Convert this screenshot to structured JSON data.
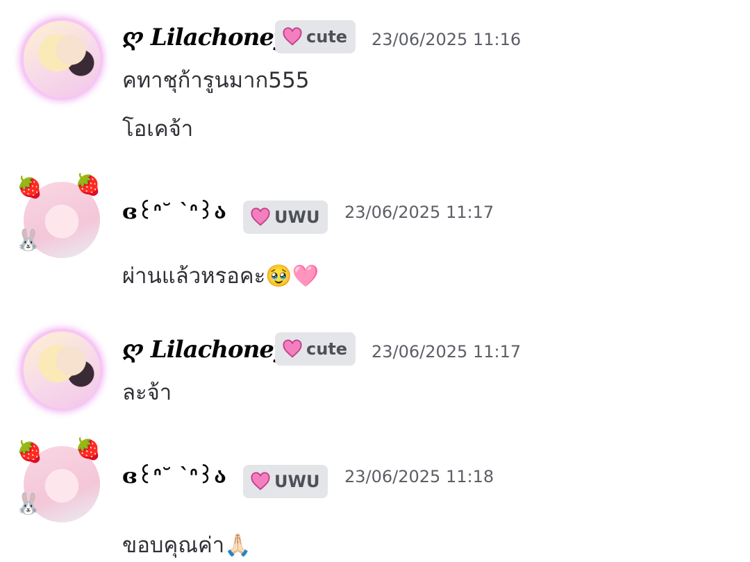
{
  "messages": [
    {
      "username": "ღ 𝑳𝒊𝒍𝒂𝒄𝒉𝒐𝒏𝒆𝒚",
      "tag": "cute",
      "timestamp": "23/06/2025 11:16",
      "lines": [
        "คทาชุก้ารูนมาก555",
        "โอเคจ้า"
      ]
    },
    {
      "username": "ɞ꒰ᐢ˘ `ᐢ꒱ა",
      "tag": "UWU",
      "timestamp": "23/06/2025 11:17",
      "lines": [
        "ผ่านแล้วหรอคะ🥹🩷"
      ]
    },
    {
      "username": "ღ 𝑳𝒊𝒍𝒂𝒄𝒉𝒐𝒏𝒆𝒚",
      "tag": "cute",
      "timestamp": "23/06/2025 11:17",
      "lines": [
        "ละจ้า"
      ]
    },
    {
      "username": "ɞ꒰ᐢ˘ `ᐢ꒱ა",
      "tag": "UWU",
      "timestamp": "23/06/2025 11:18",
      "lines": [
        "ขอบคุณค่า🙏🏻"
      ]
    }
  ],
  "colors": {
    "tag_bg": "#e3e5e8",
    "heart": "#f47fbf",
    "timestamp": "#5c5e66",
    "text": "#2e3035"
  }
}
